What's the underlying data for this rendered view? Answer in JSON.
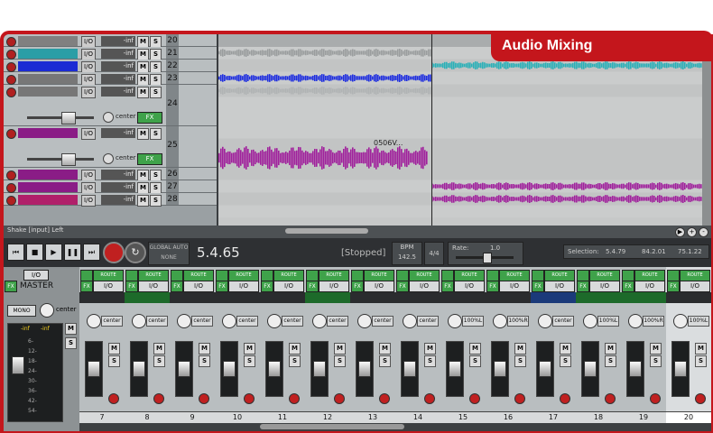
{
  "banner": {
    "title": "Audio Mixing"
  },
  "colors": {
    "accent": "#c4161c",
    "purple": "#a0209c",
    "blue": "#1d2de0",
    "teal": "#2ab0b8",
    "gray_wave": "#9a9d9e"
  },
  "tcp": {
    "tracks": [
      {
        "num": "20",
        "io": "I/O",
        "vol": "-inf",
        "m": "M",
        "s": "S",
        "color": "#808080"
      },
      {
        "num": "21",
        "io": "I/O",
        "vol": "-inf",
        "m": "M",
        "s": "S",
        "color": "#2a9ea6"
      },
      {
        "num": "22",
        "io": "I/O",
        "vol": "-inf",
        "m": "M",
        "s": "S",
        "color": "#1b2bd4"
      },
      {
        "num": "23",
        "io": "I/O",
        "vol": "-inf",
        "m": "M",
        "s": "S",
        "color": "#777777"
      },
      {
        "num": "24",
        "io": "I/O",
        "vol": "-inf",
        "m": "M",
        "s": "S",
        "pan": "center",
        "fx": "FX",
        "color": "#777777"
      },
      {
        "num": "25",
        "io": "I/O",
        "vol": "-inf",
        "m": "M",
        "s": "S",
        "pan": "center",
        "fx": "FX",
        "color": "#8a1c86"
      },
      {
        "num": "26",
        "io": "I/O",
        "vol": "-inf",
        "m": "M",
        "s": "S",
        "color": "#8a1c86"
      },
      {
        "num": "27",
        "io": "I/O",
        "vol": "-inf",
        "m": "M",
        "s": "S",
        "color": "#8a1c86"
      },
      {
        "num": "28",
        "io": "I/O",
        "vol": "-inf",
        "m": "M",
        "s": "S",
        "color": "#b0206a"
      }
    ]
  },
  "arrange": {
    "item_label": "0506V..."
  },
  "hbar": {
    "label": "Shake [input] Left",
    "zoom_in": "+",
    "zoom_out": "-"
  },
  "transport": {
    "buttons": [
      "⏮",
      "■",
      "▶",
      "❚❚",
      "⏭"
    ],
    "loop": "↻",
    "global_auto_label": "GLOBAL AUTO",
    "global_auto_value": "NONE",
    "position": "5.4.65",
    "status": "[Stopped]",
    "bpm_label": "BPM",
    "bpm_value": "142.5",
    "timesig": "4/4",
    "rate_label": "Rate:",
    "rate_value": "1.0",
    "selection_label": "Selection:",
    "selection_start": "5.4.79",
    "selection_end": "84.2.01",
    "selection_len": "75.1.22"
  },
  "master": {
    "io": "I/O",
    "name": "MASTER",
    "mono": "MONO",
    "pan": "center",
    "m": "M",
    "s": "S",
    "left_peak": "-inf",
    "right_peak": "-inf",
    "scale": [
      "6-",
      "12-",
      "18-",
      "24-",
      "30-",
      "36-",
      "42-",
      "54-"
    ]
  },
  "mixer": {
    "route_label": "ROUTE",
    "strips": [
      {
        "num": "7",
        "io": "I/O",
        "pan": "center",
        "fx": "FX",
        "m": "M",
        "s": "S",
        "color": "#2a2c2e"
      },
      {
        "num": "8",
        "io": "I/O",
        "pan": "center",
        "fx": "FX",
        "m": "M",
        "s": "S",
        "color": "#1d6a2a"
      },
      {
        "num": "9",
        "io": "I/O",
        "pan": "center",
        "fx": "FX",
        "m": "M",
        "s": "S",
        "color": "#2a2c2e"
      },
      {
        "num": "10",
        "io": "I/O",
        "pan": "center",
        "fx": "FX",
        "m": "M",
        "s": "S",
        "color": "#2a2c2e"
      },
      {
        "num": "11",
        "io": "I/O",
        "pan": "center",
        "fx": "FX",
        "m": "M",
        "s": "S",
        "color": "#2a2c2e"
      },
      {
        "num": "12",
        "io": "I/O",
        "pan": "center",
        "fx": "FX",
        "m": "M",
        "s": "S",
        "color": "#1d6a2a"
      },
      {
        "num": "13",
        "io": "I/O",
        "pan": "center",
        "fx": "FX",
        "m": "M",
        "s": "S",
        "color": "#2a2c2e"
      },
      {
        "num": "14",
        "io": "I/O",
        "pan": "center",
        "fx": "FX",
        "m": "M",
        "s": "S",
        "color": "#2a2c2e"
      },
      {
        "num": "15",
        "io": "I/O",
        "pan": "100%L",
        "fx": "FX",
        "m": "M",
        "s": "S",
        "color": "#2a2c2e"
      },
      {
        "num": "16",
        "io": "I/O",
        "pan": "100%R",
        "fx": "FX",
        "m": "M",
        "s": "S",
        "color": "#2a2c2e"
      },
      {
        "num": "17",
        "io": "I/O",
        "pan": "center",
        "fx": "FX",
        "m": "M",
        "s": "S",
        "color": "#1b3a7a"
      },
      {
        "num": "18",
        "io": "I/O",
        "pan": "100%L",
        "fx": "FX",
        "m": "M",
        "s": "S",
        "color": "#1d6a2a"
      },
      {
        "num": "19",
        "io": "I/O",
        "pan": "100%R",
        "fx": "FX",
        "m": "M",
        "s": "S",
        "color": "#1d6a2a"
      },
      {
        "num": "20",
        "io": "I/O",
        "pan": "100%L",
        "fx": "FX",
        "m": "M",
        "s": "S",
        "color": "#2a2c2e"
      }
    ]
  }
}
